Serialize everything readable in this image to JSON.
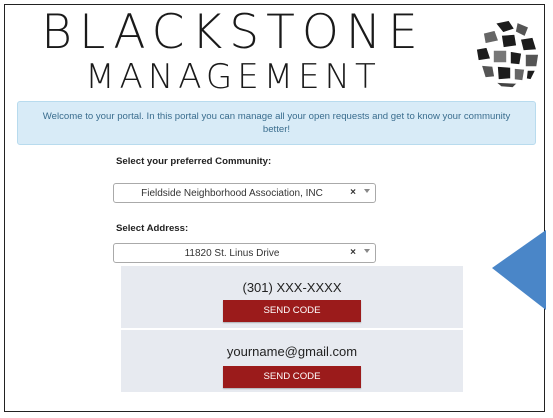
{
  "brand": {
    "line1": "BLACKSTONE",
    "line2": "MANAGEMENT",
    "logo_icon": "stone-mosaic-logo"
  },
  "welcome_message": "Welcome to your portal. In this portal you can manage all your open requests and get to know your community better!",
  "community": {
    "label": "Select your preferred Community:",
    "selected": "Fieldside Neighborhood Association, INC",
    "clear_symbol": "×"
  },
  "address": {
    "label": "Select Address:",
    "selected": "11820 St. Linus Drive",
    "clear_symbol": "×"
  },
  "phone_option": {
    "value": "(301) XXX-XXXX",
    "button_label": "SEND CODE"
  },
  "email_option": {
    "value": "yourname@gmail.com",
    "button_label": "SEND CODE"
  },
  "colors": {
    "accent": "#9b1b1b",
    "welcome_bg": "#d8ebf7",
    "panel_bg": "#e7eaf0",
    "callout": "#4a86c8"
  }
}
